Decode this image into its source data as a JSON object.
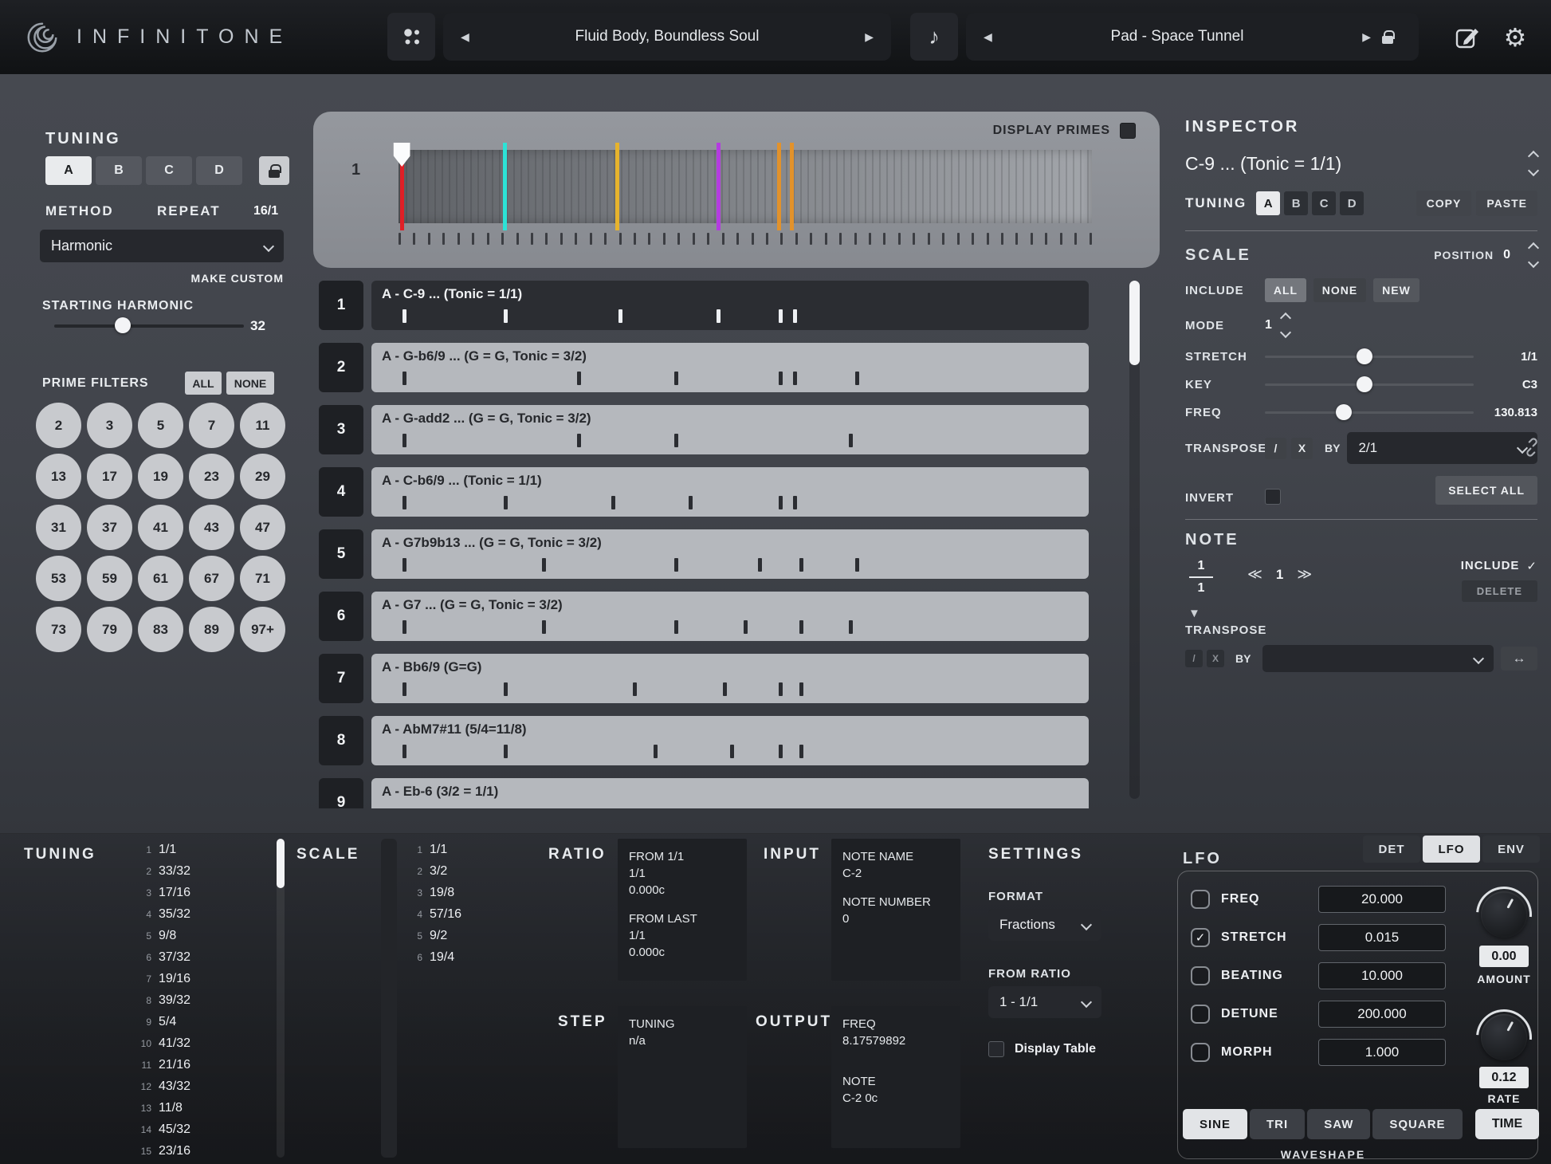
{
  "app": {
    "title": "INFINITONE"
  },
  "icons": {
    "prev": "◀",
    "next": "▶",
    "note": "♪",
    "gear": "⚙",
    "check": "✓",
    "triangle_down": "▼",
    "swap": "↔"
  },
  "header": {
    "preset_song": "Fluid Body, Boundless Soul",
    "preset_patch": "Pad - Space Tunnel"
  },
  "tuning_panel": {
    "title": "TUNING",
    "tabs": [
      "A",
      "B",
      "C",
      "D"
    ],
    "active_tab": "A",
    "method_label": "METHOD",
    "repeat_label": "REPEAT",
    "repeat_value": "16/1",
    "method_value": "Harmonic",
    "make_custom_label": "MAKE CUSTOM",
    "starting_harmonic_label": "STARTING HARMONIC",
    "starting_harmonic_value": "32",
    "prime_filters_label": "PRIME FILTERS",
    "all_label": "ALL",
    "none_label": "NONE",
    "primes": [
      "2",
      "3",
      "5",
      "7",
      "11",
      "13",
      "17",
      "19",
      "23",
      "29",
      "31",
      "37",
      "41",
      "43",
      "47",
      "53",
      "59",
      "61",
      "67",
      "71",
      "73",
      "79",
      "83",
      "89",
      "97+"
    ]
  },
  "visualizer": {
    "display_primes_label": "DISPLAY PRIMES",
    "row_label": "1",
    "tick_count": 48,
    "markers": [
      {
        "name": "tonic",
        "pos": 0.2,
        "color": "#e01f26",
        "handle": true
      },
      {
        "name": "note-2",
        "pos": 15.0,
        "color": "#2de2d6"
      },
      {
        "name": "note-3",
        "pos": 31.3,
        "color": "#e6b32d"
      },
      {
        "name": "note-4",
        "pos": 45.9,
        "color": "#b43ce0"
      },
      {
        "name": "note-5",
        "pos": 54.6,
        "color": "#e2922b"
      },
      {
        "name": "note-6",
        "pos": 56.4,
        "color": "#e2922b"
      }
    ]
  },
  "scale_list": {
    "rows": [
      {
        "num": "1",
        "label": "A - C-9 ... (Tonic = 1/1)",
        "selected": true,
        "ticks": [
          3,
          17.5,
          34,
          48,
          57,
          59
        ]
      },
      {
        "num": "2",
        "label": "A - G-b6/9 ...  (G = G, Tonic = 3/2)",
        "selected": false,
        "ticks": [
          3,
          28,
          42,
          57,
          59,
          68
        ]
      },
      {
        "num": "3",
        "label": "A - G-add2 ...  (G = G, Tonic = 3/2)",
        "selected": false,
        "ticks": [
          3,
          28,
          42,
          67
        ]
      },
      {
        "num": "4",
        "label": "A - C-b6/9 ... (Tonic = 1/1)",
        "selected": false,
        "ticks": [
          3,
          17.5,
          33,
          44,
          57,
          59
        ]
      },
      {
        "num": "5",
        "label": "A - G7b9b13 ...  (G = G, Tonic = 3/2)",
        "selected": false,
        "ticks": [
          3,
          23,
          42,
          54,
          60,
          68
        ]
      },
      {
        "num": "6",
        "label": "A - G7 ...  (G = G, Tonic = 3/2)",
        "selected": false,
        "ticks": [
          3,
          23,
          42,
          52,
          60,
          67
        ]
      },
      {
        "num": "7",
        "label": "A - Bb6/9 (G=G)",
        "selected": false,
        "ticks": [
          3,
          17.5,
          36,
          49,
          57,
          60
        ]
      },
      {
        "num": "8",
        "label": "A - AbM7#11 (5/4=11/8)",
        "selected": false,
        "ticks": [
          3,
          17.5,
          39,
          50,
          57,
          60
        ]
      },
      {
        "num": "9",
        "label": "A - Eb-6 (3/2 = 1/1)",
        "selected": false,
        "ticks": []
      }
    ]
  },
  "inspector": {
    "title": "INSPECTOR",
    "selected_scale": "C-9 ... (Tonic = 1/1)",
    "tuning_label": "TUNING",
    "tuning_tabs": [
      "A",
      "B",
      "C",
      "D"
    ],
    "active_tuning": "A",
    "copy_label": "COPY",
    "paste_label": "PASTE",
    "scale_section": {
      "title": "SCALE",
      "position_label": "POSITION",
      "position_value": "0",
      "include_label": "INCLUDE",
      "all_label": "ALL",
      "none_label": "NONE",
      "new_label": "NEW",
      "mode_label": "MODE",
      "mode_value": "1",
      "stretch_label": "STRETCH",
      "stretch_value": "1/1",
      "key_label": "KEY",
      "key_value": "C3",
      "freq_label": "FREQ",
      "freq_value": "130.813",
      "transpose_label": "TRANSPOSE",
      "divide_label": "/",
      "multiply_label": "X",
      "by_label": "BY",
      "transpose_by_value": "2/1",
      "invert_label": "INVERT",
      "select_all_label": "SELECT ALL"
    },
    "note_section": {
      "title": "NOTE",
      "ratio_numerator": "1",
      "ratio_denominator": "1",
      "prev_label": "≪",
      "index_value": "1",
      "next_label": "≫",
      "include_label": "INCLUDE",
      "delete_label": "DELETE",
      "transpose_label": "TRANSPOSE",
      "divide_label": "/",
      "multiply_label": "X",
      "by_label": "BY"
    }
  },
  "bottom": {
    "tuning": {
      "title": "TUNING",
      "items": [
        "1/1",
        "33/32",
        "17/16",
        "35/32",
        "9/8",
        "37/32",
        "19/16",
        "39/32",
        "5/4",
        "41/32",
        "21/16",
        "43/32",
        "11/8",
        "45/32",
        "23/16"
      ]
    },
    "scale": {
      "title": "SCALE",
      "items": [
        "1/1",
        "3/2",
        "19/8",
        "57/16",
        "9/2",
        "19/4"
      ]
    },
    "ratio": {
      "title": "RATIO",
      "from_first_label": "FROM 1/1",
      "from_first_ratio": "1/1",
      "from_first_cents": "0.000c",
      "from_last_label": "FROM LAST",
      "from_last_ratio": "1/1",
      "from_last_cents": "0.000c"
    },
    "step": {
      "title": "STEP",
      "tuning_label": "TUNING",
      "tuning_value": "n/a"
    },
    "input": {
      "title": "INPUT",
      "note_name_label": "NOTE NAME",
      "note_name_value": "C-2",
      "note_number_label": "NOTE NUMBER",
      "note_number_value": "0"
    },
    "output": {
      "title": "OUTPUT",
      "freq_label": "FREQ",
      "freq_value": "8.17579892",
      "note_label": "NOTE",
      "note_value": "C-2 0c"
    },
    "settings": {
      "title": "SETTINGS",
      "format_label": "FORMAT",
      "format_value": "Fractions",
      "from_ratio_label": "FROM RATIO",
      "from_ratio_value": "1 - 1/1",
      "display_table_label": "Display Table"
    },
    "lfo": {
      "title": "LFO",
      "tabs": [
        "DET",
        "LFO",
        "ENV"
      ],
      "active_tab": "LFO",
      "rows": [
        {
          "label": "FREQ",
          "value": "20.000",
          "checked": false
        },
        {
          "label": "STRETCH",
          "value": "0.015",
          "checked": true
        },
        {
          "label": "BEATING",
          "value": "10.000",
          "checked": false
        },
        {
          "label": "DETUNE",
          "value": "200.000",
          "checked": false
        },
        {
          "label": "MORPH",
          "value": "1.000",
          "checked": false
        }
      ],
      "amount_value": "0.00",
      "amount_label": "AMOUNT",
      "rate_value": "0.12",
      "rate_label": "RATE",
      "waveshapes": [
        "SINE",
        "TRI",
        "SAW",
        "SQUARE"
      ],
      "active_waveshape": "SINE",
      "time_label": "TIME",
      "waveshape_label": "WAVESHAPE"
    }
  }
}
